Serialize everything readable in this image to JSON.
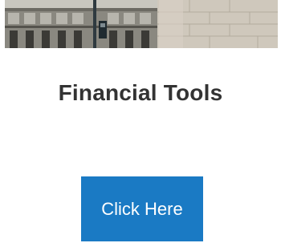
{
  "page": {
    "title": "Financial Tools"
  },
  "cta": {
    "label": "Click Here",
    "color": "#1a7ac4"
  },
  "banner": {
    "subject": "stone building facade with street lamp"
  }
}
